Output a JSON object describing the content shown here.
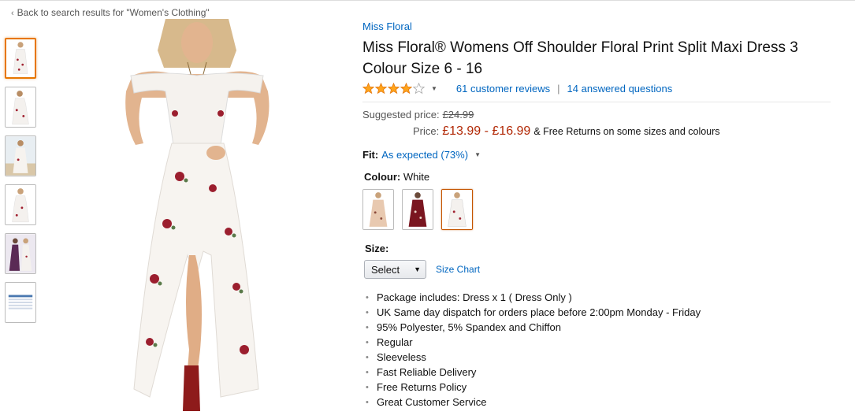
{
  "nav": {
    "back_link": "Back to search results for \"Women's Clothing\""
  },
  "thumbnails": [
    {
      "name": "thumb-front-white",
      "active": true
    },
    {
      "name": "thumb-side-white",
      "active": false
    },
    {
      "name": "thumb-beach-white",
      "active": false
    },
    {
      "name": "thumb-back-white",
      "active": false
    },
    {
      "name": "thumb-pair",
      "active": false
    },
    {
      "name": "thumb-size-chart",
      "active": false
    }
  ],
  "product": {
    "brand": "Miss Floral",
    "title": "Miss Floral® Womens Off Shoulder Floral Print Split Maxi Dress 3 Colour Size 6 - 16",
    "rating": 4,
    "rating_max": 5,
    "reviews": "61 customer reviews",
    "separator": "|",
    "answered": "14 answered questions"
  },
  "price": {
    "suggested_label": "Suggested price:",
    "suggested_value": "£24.99",
    "price_label": "Price:",
    "price_value": "£13.99 - £16.99",
    "price_note": "& Free Returns on some sizes and colours"
  },
  "fit": {
    "label": "Fit:",
    "value": "As expected (73%)"
  },
  "colour": {
    "label": "Colour:",
    "selected": "White",
    "options": [
      {
        "name": "beige",
        "color": "#e8c9b0"
      },
      {
        "name": "burgundy",
        "color": "#7a1620"
      },
      {
        "name": "white",
        "color": "#ffffff"
      }
    ]
  },
  "size": {
    "label": "Size:",
    "select_value": "Select",
    "size_chart": "Size Chart"
  },
  "features": [
    "Package includes: Dress x 1 ( Dress Only )",
    "UK Same day dispatch for orders place before 2:00pm Monday - Friday",
    "95% Polyester, 5% Spandex and Chiffon",
    "Regular",
    "Sleeveless",
    "Fast Reliable Delivery",
    "Free Returns Policy",
    "Great Customer Service"
  ],
  "colors": {
    "link": "#0066c0",
    "price": "#b12704",
    "star": "#ffa41c",
    "active_border": "#e77600"
  }
}
